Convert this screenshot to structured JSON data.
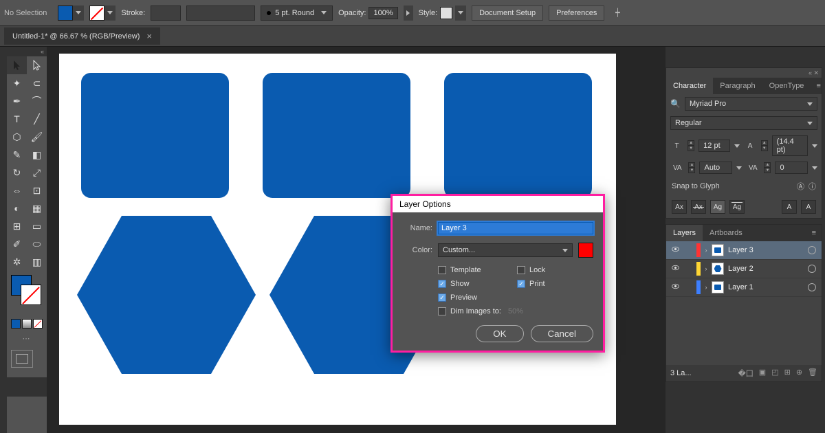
{
  "topbar": {
    "selection": "No Selection",
    "stroke_label": "Stroke:",
    "brush": "5 pt. Round",
    "opacity_label": "Opacity:",
    "opacity_value": "100%",
    "style_label": "Style:",
    "doc_setup": "Document Setup",
    "preferences": "Preferences"
  },
  "tab": {
    "title": "Untitled-1* @ 66.67 % (RGB/Preview)",
    "close": "×"
  },
  "dialog": {
    "title": "Layer Options",
    "name_label": "Name:",
    "name_value": "Layer 3",
    "color_label": "Color:",
    "color_value": "Custom...",
    "template": "Template",
    "lock": "Lock",
    "show": "Show",
    "print": "Print",
    "preview": "Preview",
    "dim": "Dim Images to:",
    "dim_val": "50%",
    "ok": "OK",
    "cancel": "Cancel"
  },
  "char_panel": {
    "tab_character": "Character",
    "tab_paragraph": "Paragraph",
    "tab_opentype": "OpenType",
    "font": "Myriad Pro",
    "weight": "Regular",
    "size": "12 pt",
    "leading": "(14.4 pt)",
    "kerning": "Auto",
    "tracking": "0",
    "snap": "Snap to Glyph"
  },
  "layers_panel": {
    "tab_layers": "Layers",
    "tab_artboards": "Artboards",
    "rows": [
      {
        "name": "Layer 3"
      },
      {
        "name": "Layer 2"
      },
      {
        "name": "Layer 1"
      }
    ],
    "count": "3 La..."
  }
}
